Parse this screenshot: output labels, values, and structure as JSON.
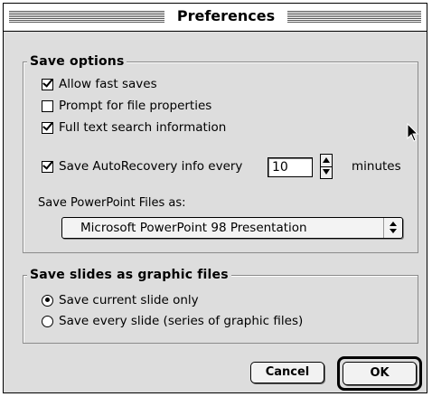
{
  "window": {
    "title": "Preferences"
  },
  "save_options": {
    "group_label": "Save options",
    "allow_fast_saves": {
      "label": "Allow fast saves",
      "checked": true
    },
    "prompt_file_properties": {
      "label": "Prompt for file properties",
      "checked": false
    },
    "full_text_search": {
      "label": "Full text search information",
      "checked": true
    },
    "autorecovery": {
      "label": "Save AutoRecovery info every",
      "checked": true,
      "value": "10",
      "unit": "minutes"
    },
    "save_as_label": "Save PowerPoint Files as:",
    "save_as_selected": "Microsoft PowerPoint 98 Presentation"
  },
  "graphic_files": {
    "group_label": "Save slides as graphic files",
    "options": [
      {
        "label": "Save current slide only",
        "selected": true
      },
      {
        "label": "Save every slide (series of graphic files)",
        "selected": false
      }
    ]
  },
  "buttons": {
    "cancel": "Cancel",
    "ok": "OK"
  },
  "icons": {
    "cursor": "arrow-cursor-icon",
    "stepper": "stepper-arrows-icon",
    "popup": "popup-arrows-icon"
  }
}
